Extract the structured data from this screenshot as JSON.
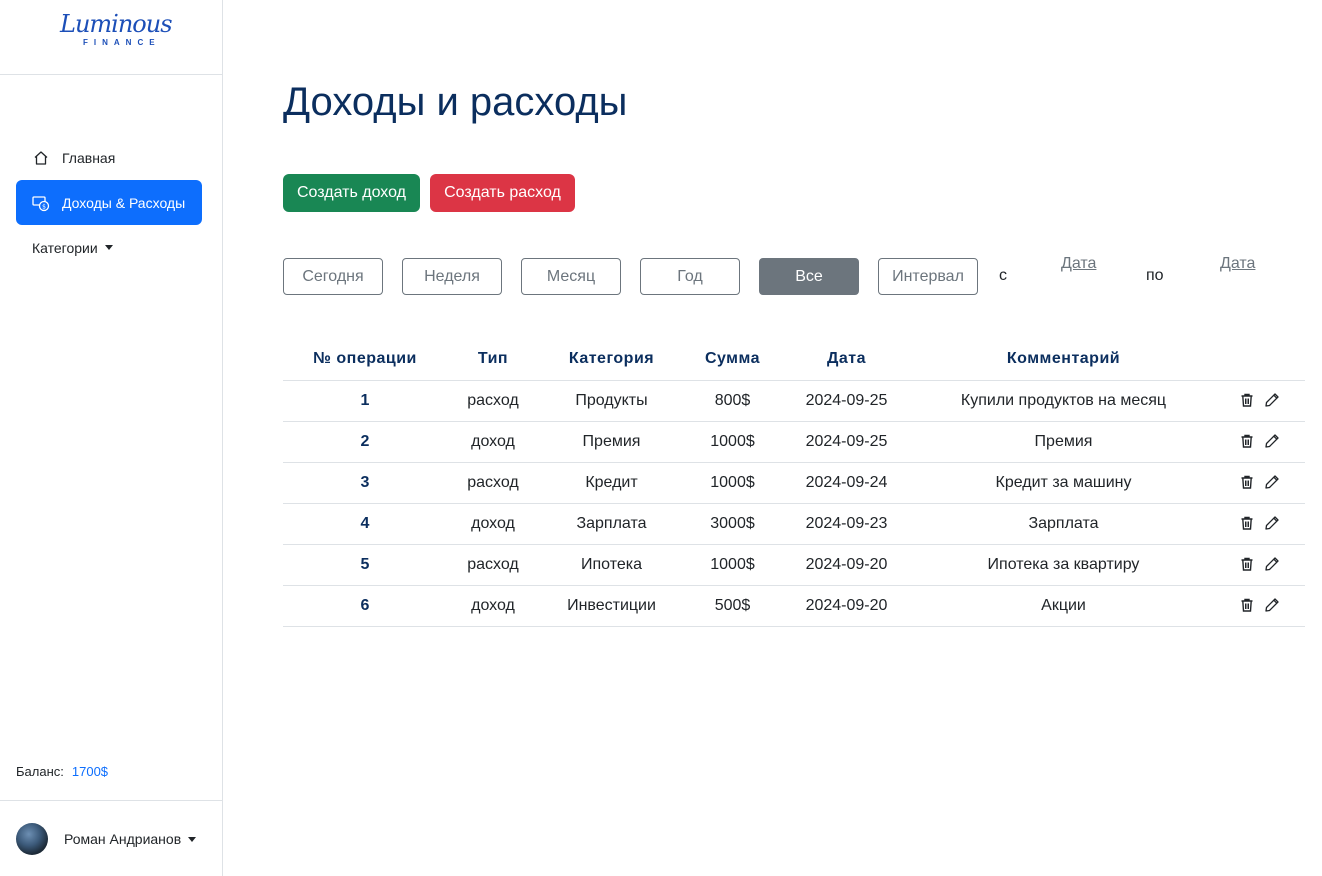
{
  "brand": {
    "script": "Luminous",
    "sub": "FINANCE"
  },
  "sidebar": {
    "items": [
      {
        "label": "Главная",
        "icon": "home-icon"
      },
      {
        "label": "Доходы & Расходы",
        "icon": "money-icon",
        "active": true
      }
    ],
    "dropdown_label": "Категории",
    "balance_label": "Баланс:",
    "balance_value": "1700$",
    "user_name": "Роман Андрианов"
  },
  "main": {
    "title": "Доходы и расходы",
    "create_income": "Создать доход",
    "create_expense": "Создать расход",
    "filters": [
      "Сегодня",
      "Неделя",
      "Месяц",
      "Год",
      "Все",
      "Интервал"
    ],
    "active_filter": "Все",
    "range_from": "с",
    "range_to": "по",
    "date_from": "Дата",
    "date_to": "Дата"
  },
  "table": {
    "headers": [
      "№ операции",
      "Тип",
      "Категория",
      "Сумма",
      "Дата",
      "Комментарий"
    ],
    "rows": [
      {
        "num": "1",
        "type": "расход",
        "category": "Продукты",
        "amount": "800$",
        "date": "2024-09-25",
        "comment": "Купили продуктов на месяц"
      },
      {
        "num": "2",
        "type": "доход",
        "category": "Премия",
        "amount": "1000$",
        "date": "2024-09-25",
        "comment": "Премия"
      },
      {
        "num": "3",
        "type": "расход",
        "category": "Кредит",
        "amount": "1000$",
        "date": "2024-09-24",
        "comment": "Кредит за машину"
      },
      {
        "num": "4",
        "type": "доход",
        "category": "Зарплата",
        "amount": "3000$",
        "date": "2024-09-23",
        "comment": "Зарплата"
      },
      {
        "num": "5",
        "type": "расход",
        "category": "Ипотека",
        "amount": "1000$",
        "date": "2024-09-20",
        "comment": "Ипотека за квартиру"
      },
      {
        "num": "6",
        "type": "доход",
        "category": "Инвестиции",
        "amount": "500$",
        "date": "2024-09-20",
        "comment": "Акции"
      }
    ]
  },
  "colors": {
    "primary": "#0d6efd",
    "success": "#198754",
    "danger": "#dc3545",
    "secondary": "#6c757d",
    "title": "#0b2e5e"
  }
}
